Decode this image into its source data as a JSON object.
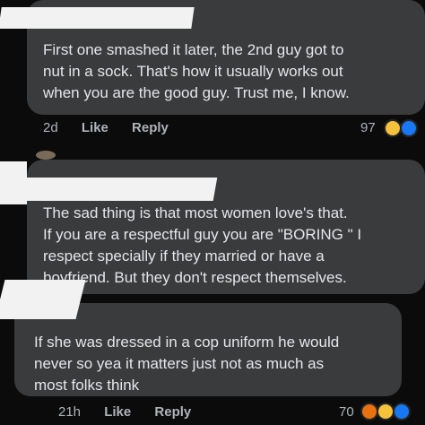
{
  "comments": [
    {
      "text": "First one smashed it later, the 2nd guy got to\nnut in a sock. That's how it usually works out\nwhen you are the good guy.  Trust me, I know.",
      "time": "2d",
      "like_label": "Like",
      "reply_label": "Reply",
      "reaction_count": "97",
      "reaction_icons": [
        "haha-emoji",
        "like-emoji"
      ]
    },
    {
      "text": "The sad thing is that most women love's that.\nIf you are a respectful guy you are \"BORING \" I\nrespect specially if they married  or have a\nboyfriend. But they don't respect themselves.",
      "time": "",
      "like_label": "",
      "reply_label": "",
      "reaction_count": "",
      "reaction_icons": []
    },
    {
      "text": "If she was dressed in a cop uniform he would\nnever so yea it matters just not as much as\nmost folks think",
      "time": "21h",
      "like_label": "Like",
      "reply_label": "Reply",
      "reaction_count": "70",
      "reaction_icons": [
        "angry-emoji",
        "haha-emoji",
        "like-emoji"
      ]
    }
  ],
  "colors": {
    "background": "#0b0b0c",
    "bubble": "#3a3b3c",
    "text": "#e4e6eb",
    "meta": "#b0b3b8",
    "redaction": "#f2f2f2"
  }
}
